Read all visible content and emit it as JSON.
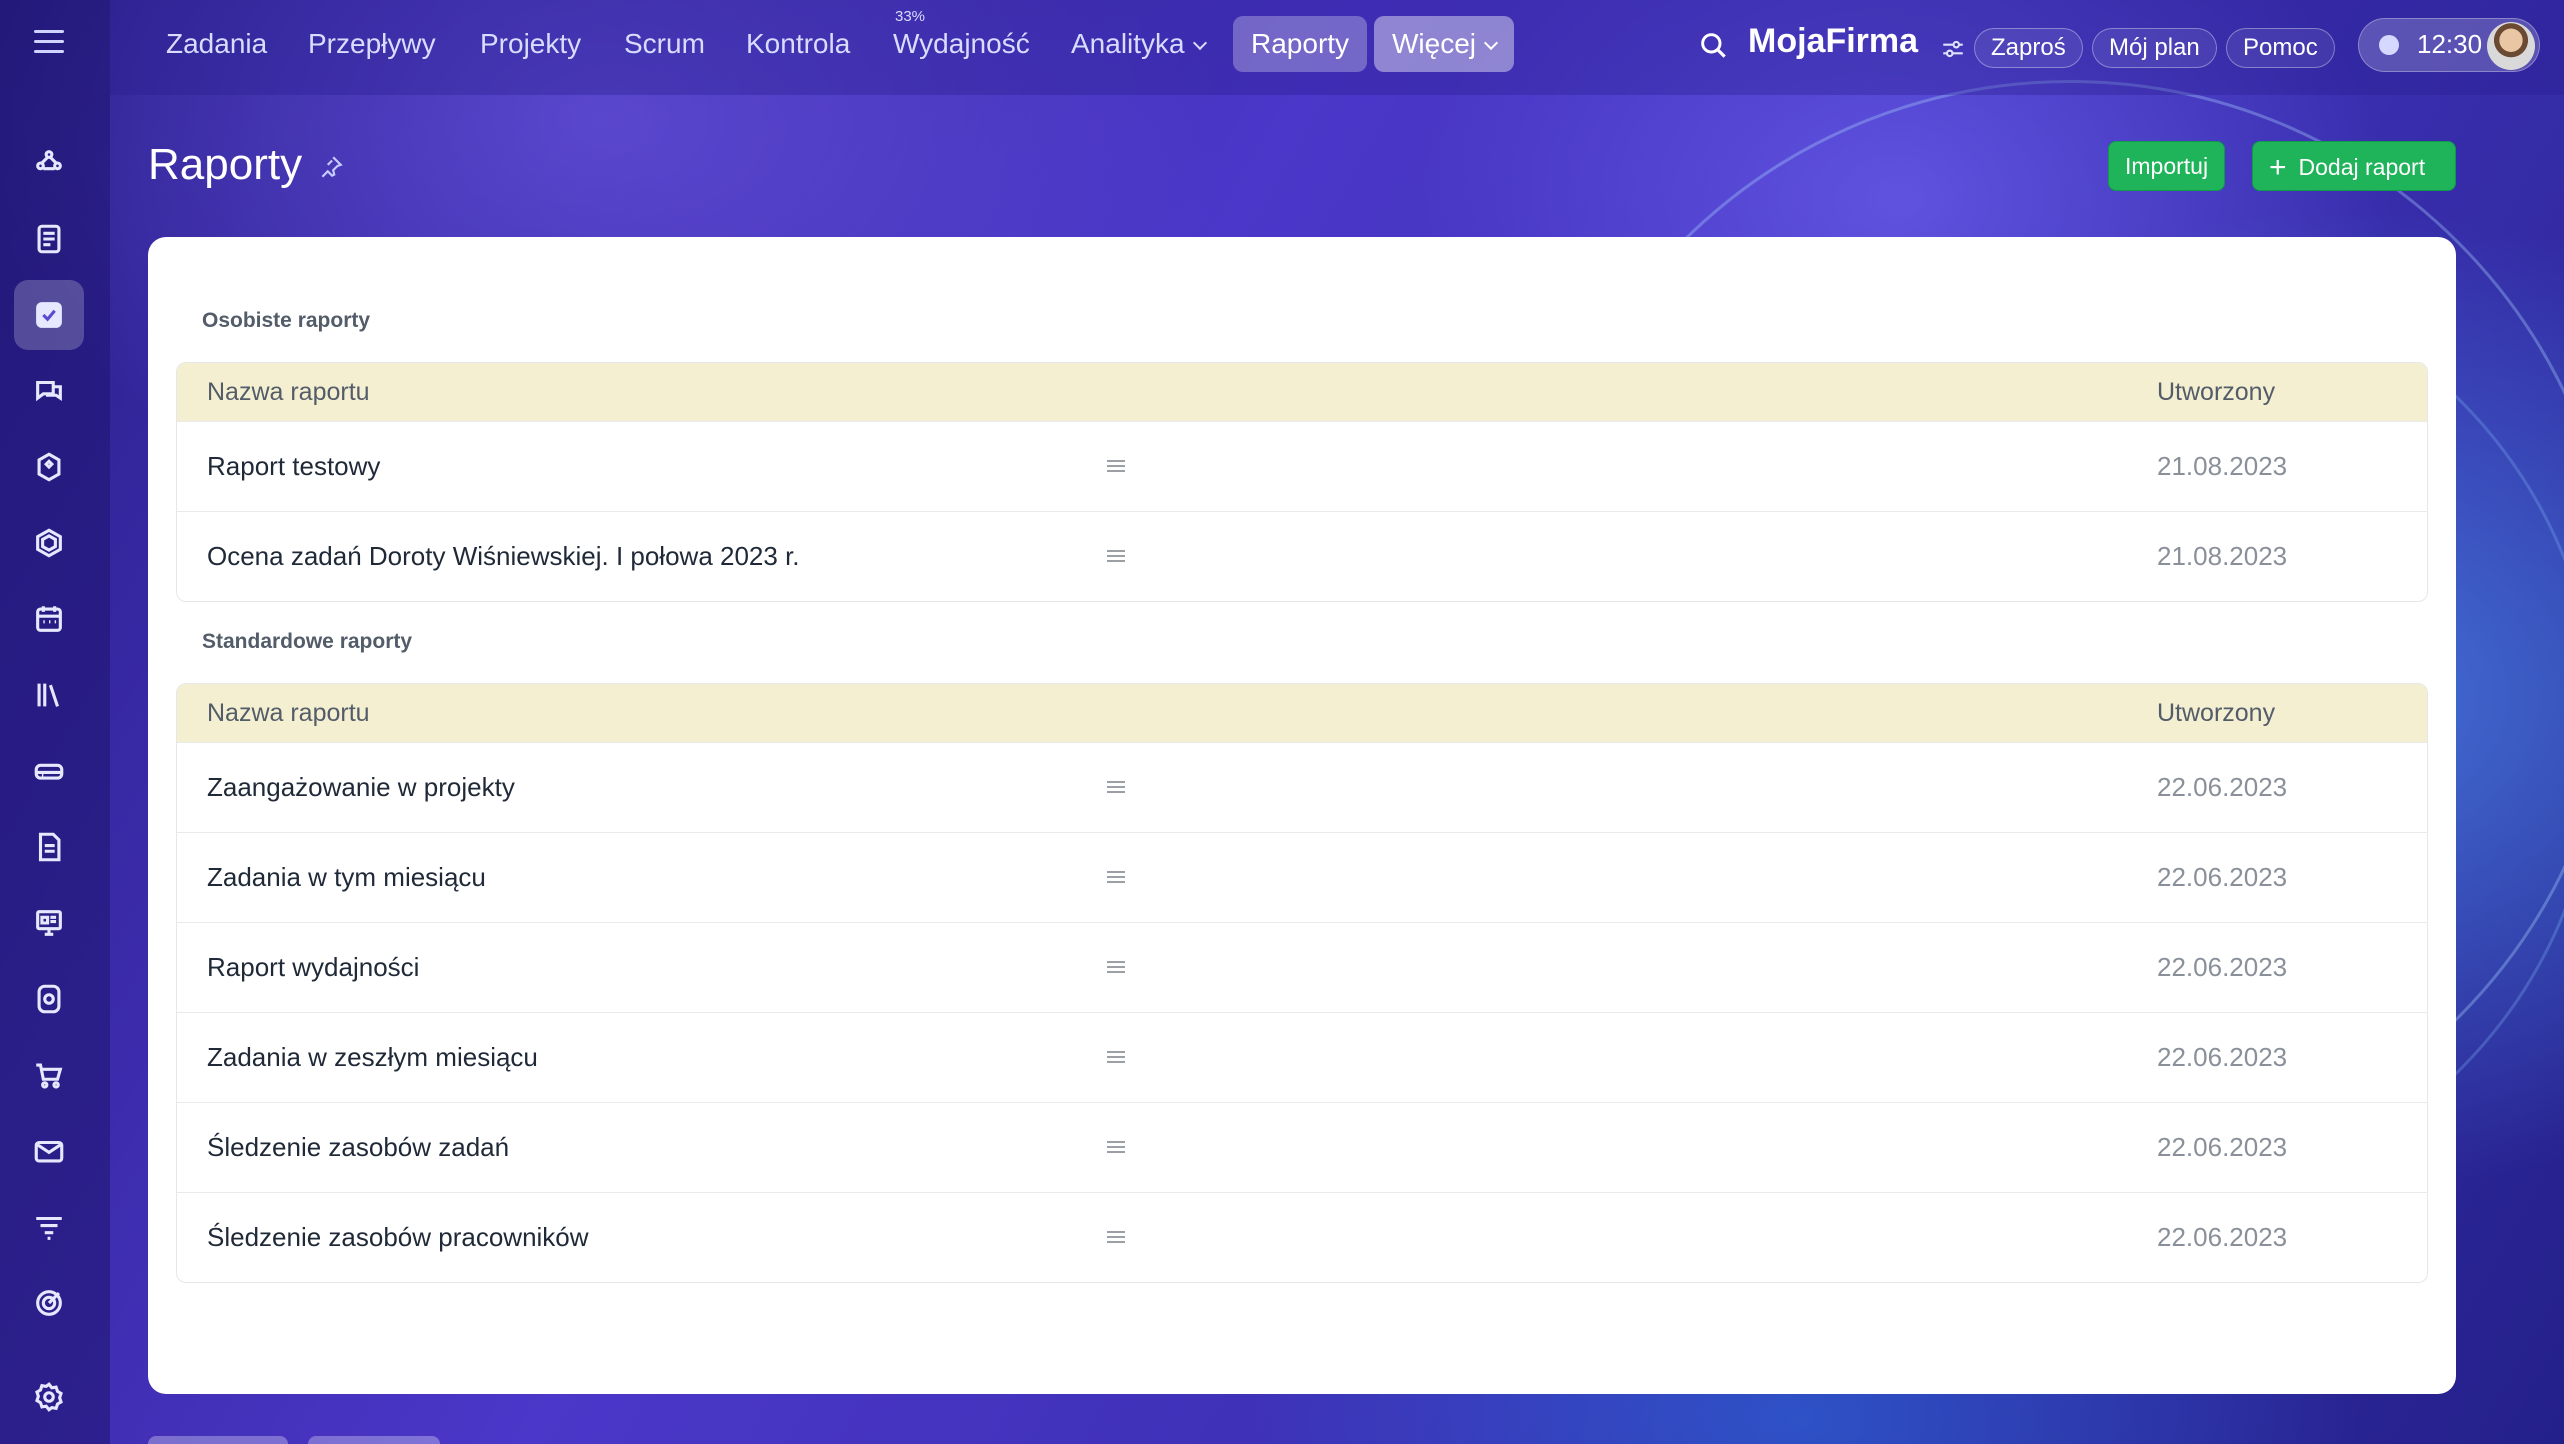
{
  "topnav": {
    "items": [
      {
        "label": "Zadania"
      },
      {
        "label": "Przepływy"
      },
      {
        "label": "Projekty"
      },
      {
        "label": "Scrum"
      },
      {
        "label": "Kontrola"
      },
      {
        "label": "Wydajność",
        "badge": "33%"
      },
      {
        "label": "Analityka"
      },
      {
        "label": "Raporty"
      },
      {
        "label": "Więcej"
      }
    ],
    "brand": "MojaFirma",
    "invite_label": "Zaproś",
    "plan_label": "Mój plan",
    "help_label": "Pomoc",
    "time": "12:30"
  },
  "page": {
    "title": "Raporty",
    "import_label": "Importuj",
    "add_label": "Dodaj raport"
  },
  "personal": {
    "section_title": "Osobiste raporty",
    "col_name": "Nazwa raportu",
    "col_created": "Utworzony",
    "rows": [
      {
        "name": "Raport testowy",
        "created": "21.08.2023"
      },
      {
        "name": "Ocena zadań Doroty Wiśniewskiej. I połowa 2023 r.",
        "created": "21.08.2023"
      }
    ]
  },
  "standard": {
    "section_title": "Standardowe raporty",
    "col_name": "Nazwa raportu",
    "col_created": "Utworzony",
    "rows": [
      {
        "name": "Zaangażowanie w projekty",
        "created": "22.06.2023"
      },
      {
        "name": "Zadania w tym miesiącu",
        "created": "22.06.2023"
      },
      {
        "name": "Raport wydajności",
        "created": "22.06.2023"
      },
      {
        "name": "Zadania w zeszłym miesiącu",
        "created": "22.06.2023"
      },
      {
        "name": "Śledzenie zasobów zadań",
        "created": "22.06.2023"
      },
      {
        "name": "Śledzenie zasobów pracowników",
        "created": "22.06.2023"
      }
    ]
  },
  "sidebar": {
    "icons": [
      "flow-icon",
      "feed-icon",
      "tasks-icon",
      "chat-icon",
      "ai-icon",
      "hexagon-icon",
      "calendar-icon",
      "books-icon",
      "drive-icon",
      "documents-icon",
      "presentation-icon",
      "contact-center-icon",
      "cart-icon",
      "mail-icon",
      "funnel-icon",
      "target-icon",
      "settings-icon"
    ]
  },
  "colors": {
    "accent_green": "#1fb35a",
    "table_header_bg": "#f5efd2"
  }
}
